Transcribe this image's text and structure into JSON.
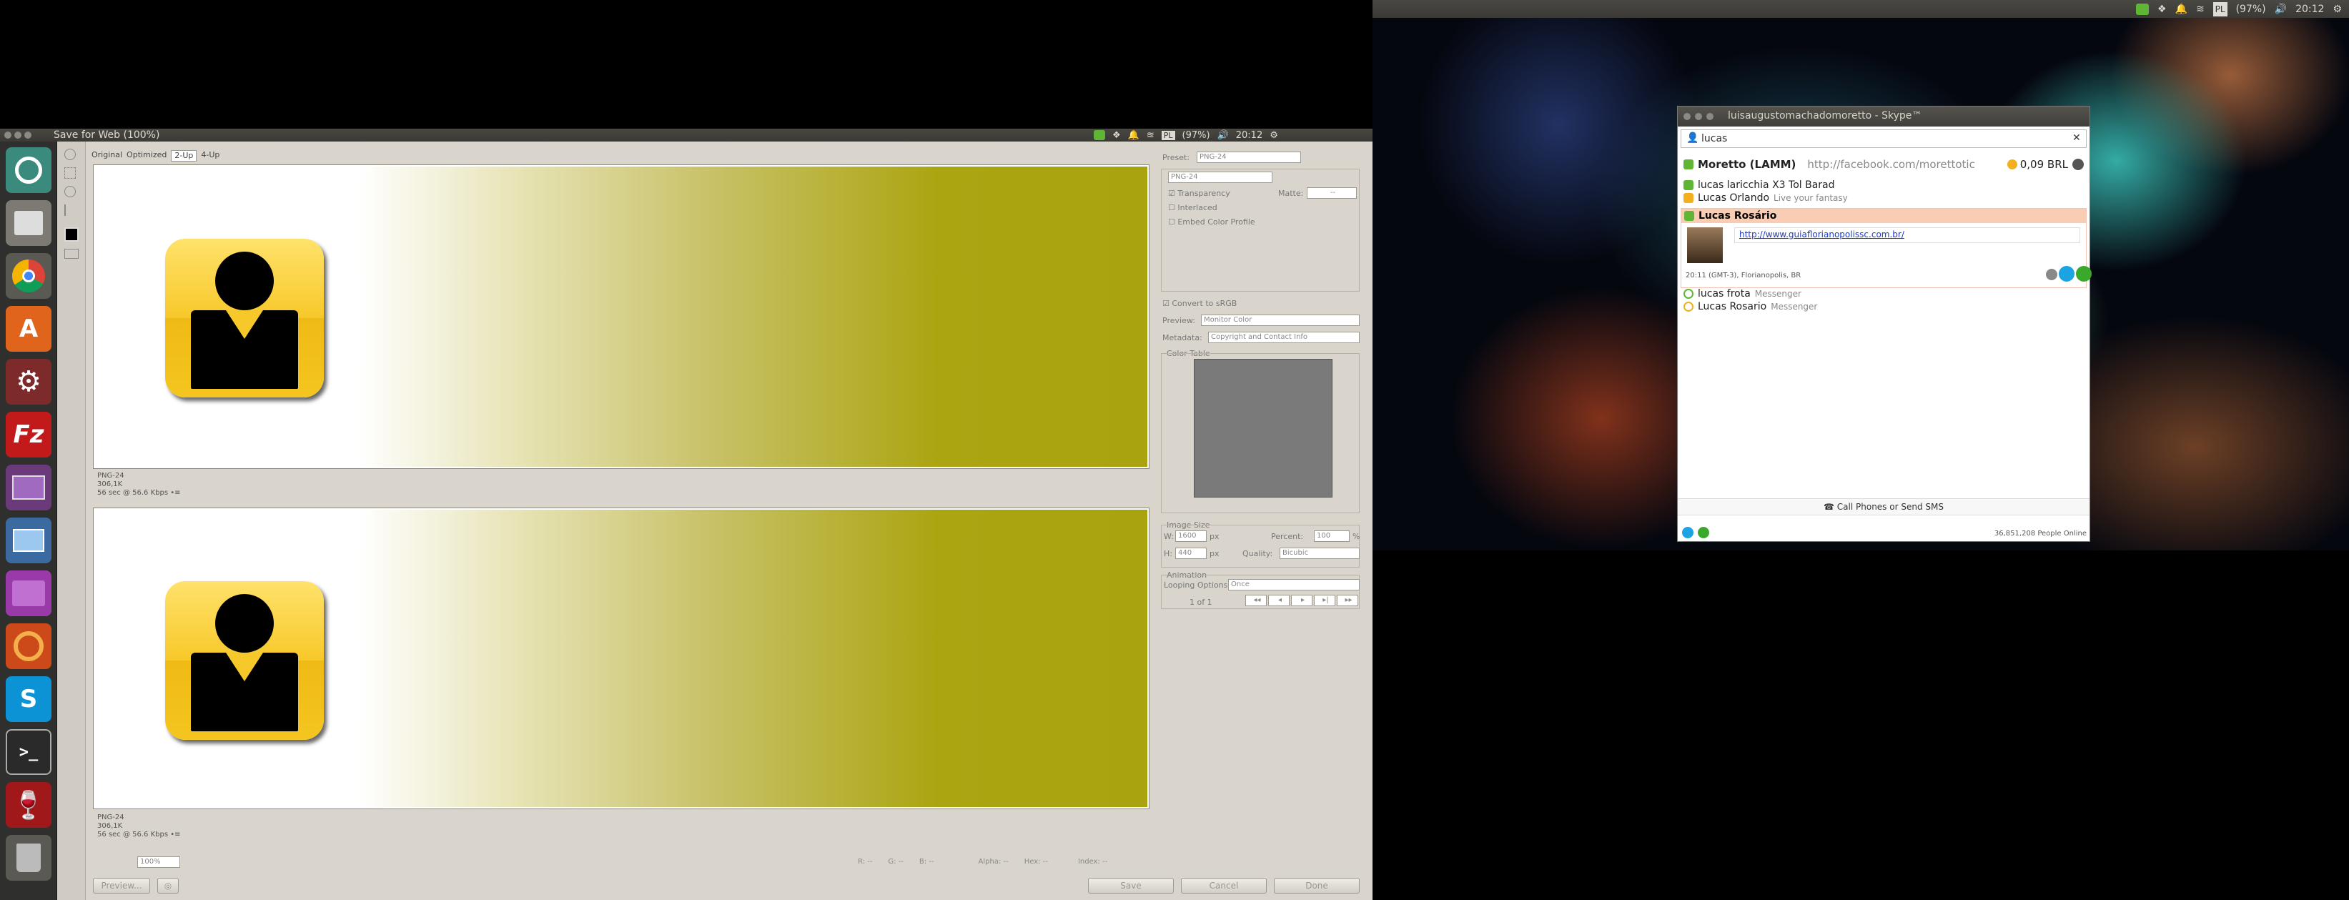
{
  "left_window": {
    "title": "Save for Web (100%)",
    "tray": {
      "battery": "(97%)",
      "clock": "20:12",
      "keyboard": "PL"
    }
  },
  "right_panel": {
    "battery": "(97%)",
    "clock": "20:12",
    "keyboard": "PL"
  },
  "launcher": {
    "items": [
      "ubuntu-home",
      "files",
      "chrome",
      "software-center",
      "system-settings",
      "filezilla",
      "workspace",
      "remote-desktop",
      "screen",
      "game",
      "skype",
      "terminal",
      "wine",
      "trash"
    ],
    "filezilla_text": "Fz",
    "skype_text": "S",
    "terminal_text": ">_",
    "softcenter_text": "A"
  },
  "photoshop": {
    "tabs": [
      "Original",
      "Optimized",
      "2-Up",
      "4-Up"
    ],
    "active_tab": "2-Up",
    "preview_top": {
      "line1": "PNG-24",
      "line2": "306,1K",
      "line3": "56 sec @ 56.6 Kbps",
      "line3b": "•≡"
    },
    "preview_bottom": {
      "line1": "PNG-24",
      "line2": "306,1K",
      "line3": "56 sec @ 56.6 Kbps",
      "line3b": "•≡"
    },
    "preset_label": "Preset:",
    "preset_value": "PNG-24",
    "format_value": "PNG-24",
    "transparency": "Transparency",
    "matte_label": "Matte:",
    "matte_value": "--",
    "interlaced": "Interlaced",
    "embed_profile": "Embed Color Profile",
    "convert_srgb": "Convert to sRGB",
    "preview_label": "Preview:",
    "preview_value": "Monitor Color",
    "metadata_label": "Metadata:",
    "metadata_value": "Copyright and Contact Info",
    "color_table": "Color Table",
    "image_size": "Image Size",
    "w_label": "W:",
    "w_value": "1600",
    "h_label": "H:",
    "h_value": "440",
    "px": "px",
    "percent_label": "Percent:",
    "percent_value": "100",
    "percent_sign": "%",
    "quality_label": "Quality:",
    "quality_value": "Bicubic",
    "animation": "Animation",
    "looping_label": "Looping Options:",
    "looping_value": "Once",
    "frame": "1 of 1",
    "zoom": "100%",
    "status": {
      "r": "R: --",
      "g": "G: --",
      "b": "B: --",
      "alpha": "Alpha: --",
      "hex": "Hex: --",
      "index": "Index: --"
    },
    "buttons": {
      "preview": "Preview...",
      "save": "Save",
      "cancel": "Cancel",
      "done": "Done"
    }
  },
  "skype": {
    "title": "luisaugustomachadomoretto - Skype™",
    "search": "lucas",
    "me_name": "Moretto (LAMM)",
    "me_mood": "http://facebook.com/morettotic",
    "balance": "0,09 BRL",
    "contacts": [
      {
        "name": "lucas laricchia X3 Tol Barad",
        "mood": ""
      },
      {
        "name": "Lucas Orlando",
        "mood": "Live your fantasy"
      }
    ],
    "selected": {
      "name": "Lucas Rosário",
      "link": "http://www.guiaflorianopolissc.com.br/",
      "info": "20:11 (GMT-3), Florianopolis, BR"
    },
    "messenger": [
      {
        "name": "lucas frota",
        "mood": "Messenger"
      },
      {
        "name": "Lucas Rosario",
        "mood": "Messenger"
      }
    ],
    "call_phones": "Call Phones or Send SMS",
    "online": "36,851,208 People Online"
  }
}
